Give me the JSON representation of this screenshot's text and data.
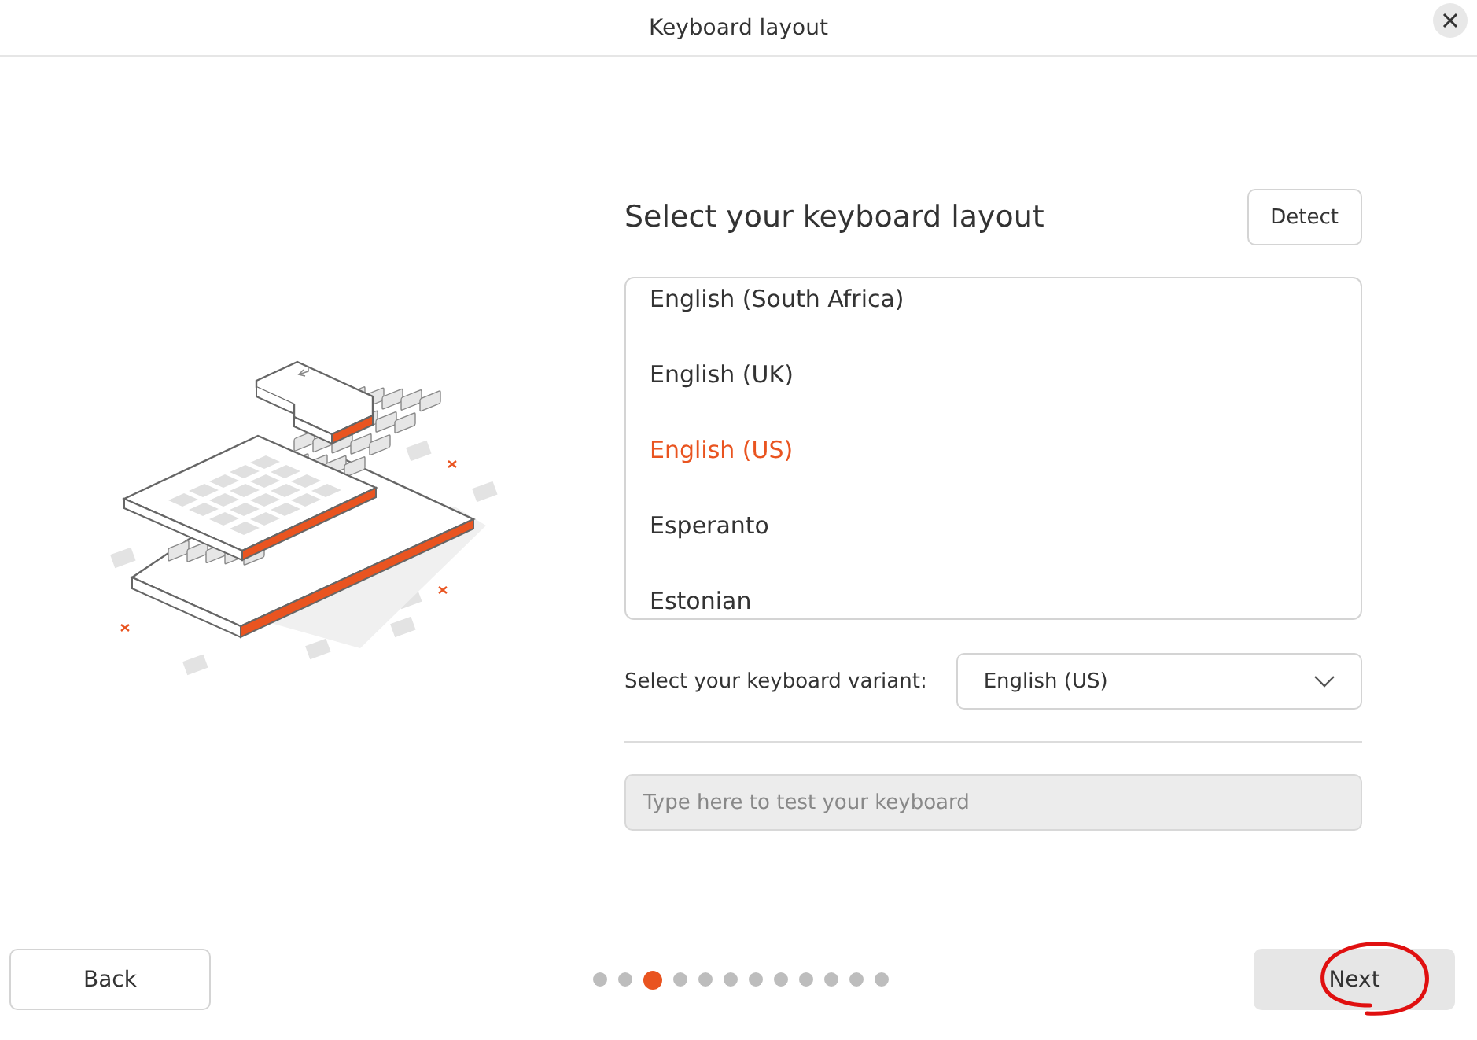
{
  "window": {
    "title": "Keyboard layout"
  },
  "heading": "Select your keyboard layout",
  "detect_button": "Detect",
  "layouts": [
    {
      "label": "English (South Africa)",
      "selected": false
    },
    {
      "label": "English (UK)",
      "selected": false
    },
    {
      "label": "English (US)",
      "selected": true
    },
    {
      "label": "Esperanto",
      "selected": false
    },
    {
      "label": "Estonian",
      "selected": false
    }
  ],
  "variant": {
    "label": "Select your keyboard variant:",
    "value": "English (US)"
  },
  "test_field": {
    "placeholder": "Type here to test your keyboard"
  },
  "back_button": "Back",
  "next_button": "Next",
  "steps": [
    {
      "selected": false
    },
    {
      "selected": false
    },
    {
      "selected": true
    },
    {
      "selected": false
    },
    {
      "selected": false
    },
    {
      "selected": false
    },
    {
      "selected": false
    },
    {
      "selected": false
    },
    {
      "selected": false
    },
    {
      "selected": false
    },
    {
      "selected": false
    },
    {
      "selected": false
    }
  ]
}
